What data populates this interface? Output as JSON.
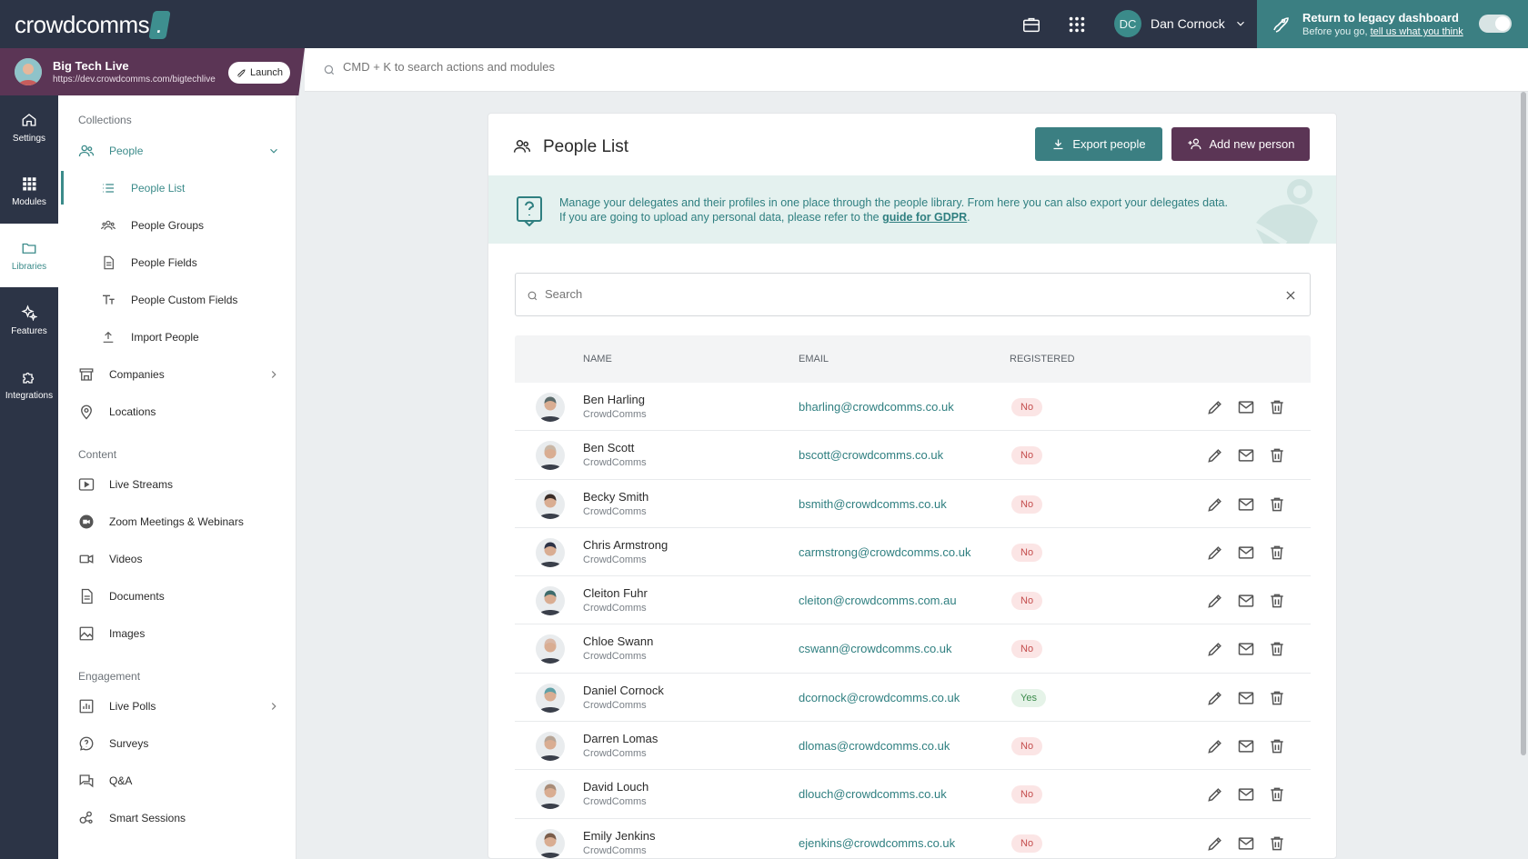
{
  "app": {
    "logo": "crowdcomms",
    "user_initials": "DC",
    "user_name": "Dan Cornock",
    "legacy_title": "Return to legacy dashboard",
    "legacy_prefix": "Before you go, ",
    "legacy_link": "tell us what you think"
  },
  "event": {
    "title": "Big Tech Live",
    "url": "https://dev.crowdcomms.com/bigtechlive",
    "launch_label": "Launch"
  },
  "command": {
    "placeholder": "CMD + K to search actions and modules"
  },
  "rail": [
    {
      "label": "Settings",
      "icon": "home-icon"
    },
    {
      "label": "Modules",
      "icon": "grid-icon"
    },
    {
      "label": "Libraries",
      "icon": "folder-icon"
    },
    {
      "label": "Features",
      "icon": "sparkle-icon"
    },
    {
      "label": "Integrations",
      "icon": "puzzle-icon"
    }
  ],
  "sidebar": {
    "collections": "Collections",
    "people": "People",
    "people_list": "People List",
    "people_groups": "People Groups",
    "people_fields": "People Fields",
    "people_custom_fields": "People Custom Fields",
    "import_people": "Import People",
    "companies": "Companies",
    "locations": "Locations",
    "content": "Content",
    "live_streams": "Live Streams",
    "zoom": "Zoom Meetings & Webinars",
    "videos": "Videos",
    "documents": "Documents",
    "images": "Images",
    "engagement": "Engagement",
    "live_polls": "Live Polls",
    "surveys": "Surveys",
    "qa": "Q&A",
    "smart_sessions": "Smart Sessions"
  },
  "main": {
    "title": "People List",
    "export_label": "Export people",
    "add_label": "Add new person",
    "info_line1": "Manage your delegates and their profiles in one place through the people library. From here you can also export your delegates data.",
    "info_line2": "If you are going to upload any personal data, please refer to the ",
    "info_link": "guide for GDPR",
    "info_end": ".",
    "search_placeholder": "Search",
    "columns": {
      "name": "NAME",
      "email": "EMAIL",
      "registered": "REGISTERED"
    }
  },
  "people": [
    {
      "name": "Ben Harling",
      "company": "CrowdComms",
      "email": "bharling@crowdcomms.co.uk",
      "registered": "No",
      "tone": "#5a6a6a"
    },
    {
      "name": "Ben Scott",
      "company": "CrowdComms",
      "email": "bscott@crowdcomms.co.uk",
      "registered": "No",
      "tone": "#c9b7a6"
    },
    {
      "name": "Becky Smith",
      "company": "CrowdComms",
      "email": "bsmith@crowdcomms.co.uk",
      "registered": "No",
      "tone": "#3a2d28"
    },
    {
      "name": "Chris Armstrong",
      "company": "CrowdComms",
      "email": "carmstrong@crowdcomms.co.uk",
      "registered": "No",
      "tone": "#2d3347"
    },
    {
      "name": "Cleiton Fuhr",
      "company": "CrowdComms",
      "email": "cleiton@crowdcomms.com.au",
      "registered": "No",
      "tone": "#3e6b6b"
    },
    {
      "name": "Chloe Swann",
      "company": "CrowdComms",
      "email": "cswann@crowdcomms.co.uk",
      "registered": "No",
      "tone": "#d9b9a8"
    },
    {
      "name": "Daniel Cornock",
      "company": "CrowdComms",
      "email": "dcornock@crowdcomms.co.uk",
      "registered": "Yes",
      "tone": "#5fa0a6"
    },
    {
      "name": "Darren Lomas",
      "company": "CrowdComms",
      "email": "dlomas@crowdcomms.co.uk",
      "registered": "No",
      "tone": "#b7a596"
    },
    {
      "name": "David Louch",
      "company": "CrowdComms",
      "email": "dlouch@crowdcomms.co.uk",
      "registered": "No",
      "tone": "#a88c78"
    },
    {
      "name": "Emily Jenkins",
      "company": "CrowdComms",
      "email": "ejenkins@crowdcomms.co.uk",
      "registered": "No",
      "tone": "#7a5d4b"
    }
  ]
}
